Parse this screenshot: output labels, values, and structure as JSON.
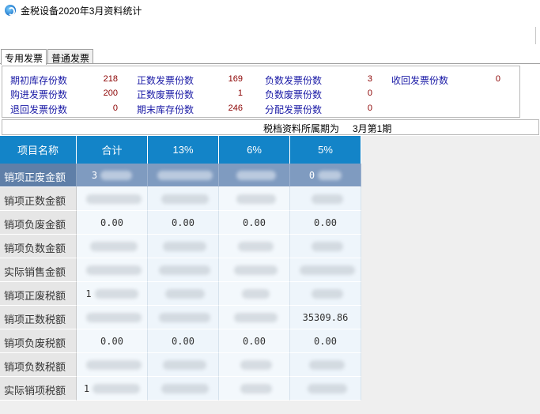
{
  "window": {
    "title": "金税设备2020年3月资料统计"
  },
  "tabs": [
    {
      "label": "专用发票",
      "active": true
    },
    {
      "label": "普通发票",
      "active": false
    }
  ],
  "stats": {
    "opening_stock_label": "期初库存份数",
    "opening_stock_value": "218",
    "positive_invoice_label": "正数发票份数",
    "positive_invoice_value": "169",
    "negative_invoice_label": "负数发票份数",
    "negative_invoice_value": "3",
    "recovered_invoice_label": "收回发票份数",
    "recovered_invoice_value": "0",
    "purchased_invoice_label": "购进发票份数",
    "purchased_invoice_value": "200",
    "positive_void_label": "正数废票份数",
    "positive_void_value": "1",
    "negative_void_label": "负数废票份数",
    "negative_void_value": "0",
    "returned_invoice_label": "退回发票份数",
    "returned_invoice_value": "0",
    "closing_stock_label": "期末库存份数",
    "closing_stock_value": "246",
    "distributed_invoice_label": "分配发票份数",
    "distributed_invoice_value": "0"
  },
  "period": {
    "label": "税档资料所属期为",
    "value": "3月第1期"
  },
  "table": {
    "headers": [
      "项目名称",
      "合计",
      "13%",
      "6%",
      "5%"
    ],
    "rows": [
      {
        "label": "销项正废金额",
        "cells": [
          "3",
          "",
          "",
          "0"
        ]
      },
      {
        "label": "销项正数金额",
        "cells": [
          "",
          "",
          "",
          ""
        ]
      },
      {
        "label": "销项负废金额",
        "cells": [
          "0.00",
          "0.00",
          "0.00",
          "0.00"
        ]
      },
      {
        "label": "销项负数金额",
        "cells": [
          "",
          "",
          "",
          ""
        ]
      },
      {
        "label": "实际销售金额",
        "cells": [
          "",
          "",
          "",
          ""
        ]
      },
      {
        "label": "销项正废税额",
        "cells": [
          "1",
          "",
          "",
          ""
        ]
      },
      {
        "label": "销项正数税额",
        "cells": [
          "",
          "",
          "",
          "35309.86"
        ]
      },
      {
        "label": "销项负废税额",
        "cells": [
          "0.00",
          "0.00",
          "0.00",
          "0.00"
        ]
      },
      {
        "label": "销项负数税额",
        "cells": [
          "",
          "",
          "",
          ""
        ]
      },
      {
        "label": "实际销项税额",
        "cells": [
          "1",
          "",
          "",
          ""
        ]
      }
    ]
  }
}
